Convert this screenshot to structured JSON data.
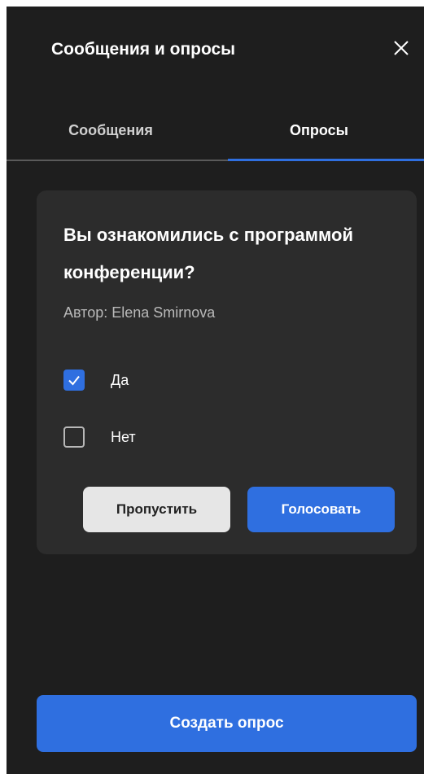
{
  "header": {
    "title": "Сообщения и опросы",
    "close_icon": "close-icon"
  },
  "tabs": [
    {
      "label": "Сообщения",
      "active": false
    },
    {
      "label": "Опросы",
      "active": true
    }
  ],
  "poll": {
    "question": "Вы ознакомились с программой конференции?",
    "author": "Автор: Elena Smirnova",
    "options": [
      {
        "label": "Да",
        "checked": true
      },
      {
        "label": "Нет",
        "checked": false
      }
    ],
    "skip_label": "Пропустить",
    "vote_label": "Голосовать"
  },
  "create_poll_label": "Создать опрос",
  "colors": {
    "panel_background": "#1e1e1e",
    "card_background": "#2c2c2c",
    "accent": "#2f6fe0",
    "skip_button": "#e6e6e6"
  }
}
